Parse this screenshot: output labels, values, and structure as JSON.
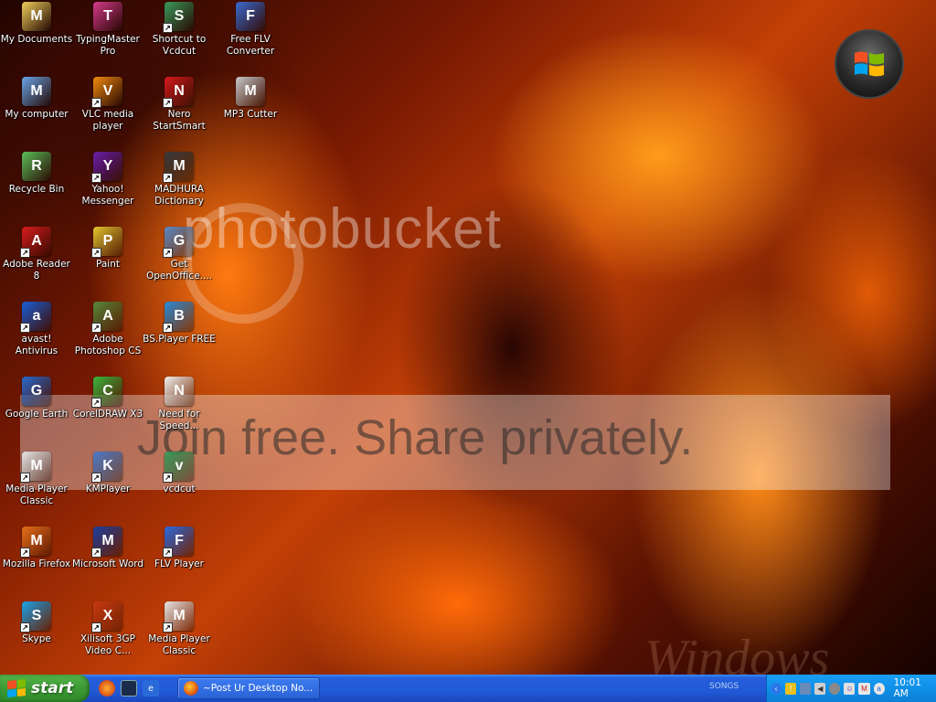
{
  "desktop": {
    "icons": [
      {
        "label": "My Documents",
        "icon": "folder-documents-icon",
        "color": "#f2cf5b",
        "shortcut": false,
        "col": 0,
        "row": 0
      },
      {
        "label": "My computer",
        "icon": "computer-icon",
        "color": "#6aa6e8",
        "shortcut": false,
        "col": 0,
        "row": 1
      },
      {
        "label": "Recycle Bin",
        "icon": "recycle-bin-icon",
        "color": "#5bbf5b",
        "shortcut": false,
        "col": 0,
        "row": 2
      },
      {
        "label": "Adobe Reader 8",
        "icon": "adobe-reader-icon",
        "color": "#d81c1c",
        "shortcut": true,
        "col": 0,
        "row": 3
      },
      {
        "label": "avast! Antivirus",
        "icon": "avast-icon",
        "color": "#1a5ed6",
        "shortcut": true,
        "col": 0,
        "row": 4
      },
      {
        "label": "Google Earth",
        "icon": "google-earth-icon",
        "color": "#2a6ad0",
        "shortcut": false,
        "col": 0,
        "row": 5
      },
      {
        "label": "Media Player Classic",
        "icon": "media-player-classic-icon",
        "color": "#e6e6e6",
        "shortcut": true,
        "col": 0,
        "row": 6
      },
      {
        "label": "Mozilla Firefox",
        "icon": "firefox-icon",
        "color": "#e8701a",
        "shortcut": true,
        "col": 0,
        "row": 7
      },
      {
        "label": "Skype",
        "icon": "skype-icon",
        "color": "#1aa3e8",
        "shortcut": true,
        "col": 0,
        "row": 8
      },
      {
        "label": "TypingMaster Pro",
        "icon": "typingmaster-icon",
        "color": "#d63a8a",
        "shortcut": false,
        "col": 1,
        "row": 0
      },
      {
        "label": "VLC media player",
        "icon": "vlc-icon",
        "color": "#f08a10",
        "shortcut": true,
        "col": 1,
        "row": 1
      },
      {
        "label": "Yahoo! Messenger",
        "icon": "yahoo-messenger-icon",
        "color": "#6b1fa8",
        "shortcut": true,
        "col": 1,
        "row": 2
      },
      {
        "label": "Paint",
        "icon": "paint-icon",
        "color": "#e8c830",
        "shortcut": true,
        "col": 1,
        "row": 3
      },
      {
        "label": "Adobe Photoshop CS",
        "icon": "photoshop-icon",
        "color": "#5a8a3a",
        "shortcut": true,
        "col": 1,
        "row": 4
      },
      {
        "label": "CorelDRAW X3",
        "icon": "coreldraw-icon",
        "color": "#3cb83c",
        "shortcut": true,
        "col": 1,
        "row": 5
      },
      {
        "label": "KMPlayer",
        "icon": "kmplayer-icon",
        "color": "#4a7ac8",
        "shortcut": true,
        "col": 1,
        "row": 6
      },
      {
        "label": "Microsoft Word",
        "icon": "microsoft-word-icon",
        "color": "#1c3fa0",
        "shortcut": true,
        "col": 1,
        "row": 7
      },
      {
        "label": "Xilisoft 3GP Video C...",
        "icon": "xilisoft-icon",
        "color": "#c83a10",
        "shortcut": true,
        "col": 1,
        "row": 8
      },
      {
        "label": "Shortcut to Vcdcut",
        "icon": "vcdcut-icon",
        "color": "#3a9a5a",
        "shortcut": true,
        "col": 2,
        "row": 0
      },
      {
        "label": "Nero StartSmart",
        "icon": "nero-icon",
        "color": "#d81c1c",
        "shortcut": true,
        "col": 2,
        "row": 1
      },
      {
        "label": "MADHURA Dictionary",
        "icon": "dictionary-icon",
        "color": "#3a3a3a",
        "shortcut": true,
        "col": 2,
        "row": 2
      },
      {
        "label": "Get OpenOffice....",
        "icon": "openoffice-icon",
        "color": "#5a8ac8",
        "shortcut": true,
        "col": 2,
        "row": 3
      },
      {
        "label": "BS.Player FREE",
        "icon": "bsplayer-icon",
        "color": "#2a8ad8",
        "shortcut": true,
        "col": 2,
        "row": 4
      },
      {
        "label": "Need for Speed...",
        "icon": "document-icon",
        "color": "#f0f0f0",
        "shortcut": false,
        "col": 2,
        "row": 5
      },
      {
        "label": "vcdcut",
        "icon": "vcdcut-icon",
        "color": "#3a9a5a",
        "shortcut": true,
        "col": 2,
        "row": 6
      },
      {
        "label": "FLV Player",
        "icon": "flv-player-icon",
        "color": "#2a6ae0",
        "shortcut": true,
        "col": 2,
        "row": 7
      },
      {
        "label": "Media Player Classic",
        "icon": "media-player-classic-icon",
        "color": "#e6e6e6",
        "shortcut": true,
        "col": 2,
        "row": 8
      },
      {
        "label": "Free FLV Converter",
        "icon": "flv-converter-icon",
        "color": "#3a6ad0",
        "shortcut": false,
        "col": 3,
        "row": 0
      },
      {
        "label": "MP3 Cutter",
        "icon": "cd-icon",
        "color": "#c8c8c8",
        "shortcut": false,
        "col": 3,
        "row": 1
      }
    ]
  },
  "watermark": {
    "logo_text": "photobucket",
    "tagline": "Join free. Share privately.",
    "background_text": "Windows"
  },
  "taskbar": {
    "start_label": "start",
    "task_button_label": "~Post Ur Desktop No...",
    "toolbar_label": "SONGS",
    "clock": "10:01 AM",
    "colors": {
      "start": "#3c9a35",
      "bar": "#245edc",
      "tray": "#1090e8"
    }
  }
}
